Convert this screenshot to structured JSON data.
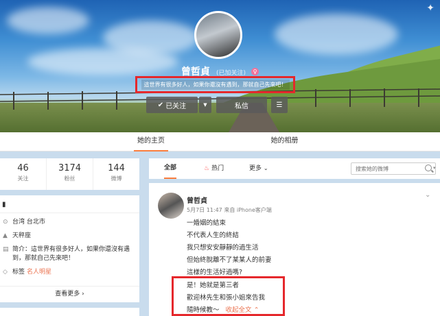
{
  "profile": {
    "name": "曾哲貞",
    "name_sub": "(已加关注)",
    "gender_icon": "female-icon",
    "bio": "這世界有很多好人，如果你還沒有遇到，那就自己先來吧！",
    "follow_label": "已关注",
    "message_label": "私信"
  },
  "tabs": {
    "home": "她的主页",
    "album": "她的相册"
  },
  "stats": [
    {
      "value": "46",
      "label": "关注"
    },
    {
      "value": "3174",
      "label": "粉丝"
    },
    {
      "value": "144",
      "label": "微博"
    }
  ],
  "info": {
    "location": "台湾 台北市",
    "zodiac": "天秤座",
    "intro": "简介：這世界有很多好人，如果你還沒有遇到，那就自己先來吧！",
    "tags_prefix": "标签",
    "tags_value": "名人明星",
    "more": "查看更多"
  },
  "feed_filter": {
    "all": "全部",
    "hot": "热门",
    "more": "更多",
    "search_placeholder": "搜索她的微博"
  },
  "post": {
    "author": "曾哲貞",
    "meta": "5月7日 11:47 来自 iPhone客户端",
    "lines": [
      "一婚姻的結束",
      "不代表人生的終結",
      "我只想安安靜靜的過生活",
      "但始終脫離不了某某人的前妻",
      "這樣的生活好過嗎?"
    ],
    "highlight_lines": [
      "是！她就是第三者",
      "歡迎林先生和張小姐來告我",
      "隨時候教～"
    ],
    "collapse": "收起全文"
  },
  "colors": {
    "accent": "#fa7d3c",
    "highlight_box": "#e5282c",
    "tag": "#eb7350"
  }
}
